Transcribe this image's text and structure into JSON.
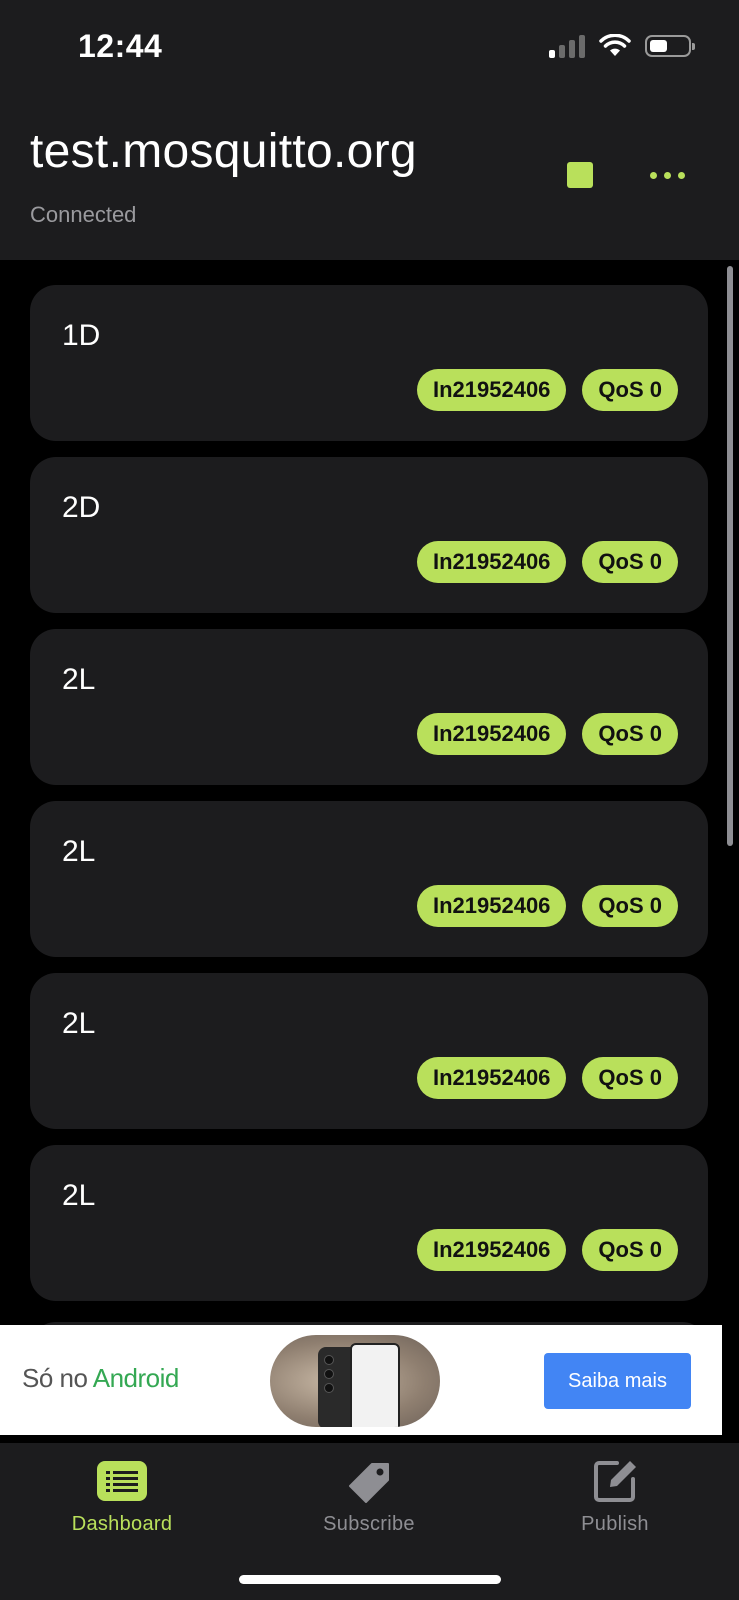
{
  "status_bar": {
    "time": "12:44"
  },
  "header": {
    "title": "test.mosquitto.org",
    "status": "Connected"
  },
  "subscriptions": [
    {
      "name": "1D",
      "topic": "In21952406",
      "qos": "QoS 0"
    },
    {
      "name": "2D",
      "topic": "In21952406",
      "qos": "QoS 0"
    },
    {
      "name": "2L",
      "topic": "In21952406",
      "qos": "QoS 0"
    },
    {
      "name": "2L",
      "topic": "In21952406",
      "qos": "QoS 0"
    },
    {
      "name": "2L",
      "topic": "In21952406",
      "qos": "QoS 0"
    },
    {
      "name": "2L",
      "topic": "In21952406",
      "qos": "QoS 0"
    }
  ],
  "ad": {
    "text_prefix": "Só no ",
    "text_brand": "Android",
    "cta": "Saiba mais"
  },
  "tabs": [
    {
      "label": "Dashboard",
      "icon": "list-icon",
      "active": true
    },
    {
      "label": "Subscribe",
      "icon": "tag-icon",
      "active": false
    },
    {
      "label": "Publish",
      "icon": "edit-icon",
      "active": false
    }
  ],
  "colors": {
    "accent": "#b9e05b",
    "card": "#1c1c1e",
    "background": "#000000",
    "ad_button": "#4285f4"
  }
}
